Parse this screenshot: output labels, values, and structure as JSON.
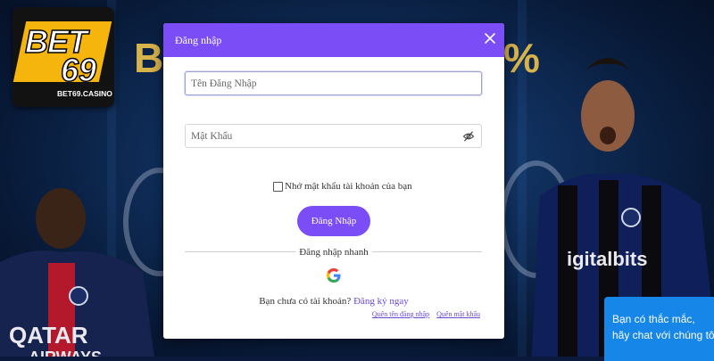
{
  "brand": {
    "logo_text_top": "BET",
    "logo_text_bottom": "69",
    "logo_subtext": "BET69.CASINO",
    "accent_color": "#7b4df6"
  },
  "login_modal": {
    "title": "Đăng nhập",
    "close_icon": "close-icon",
    "username_placeholder": "Tên Đăng Nhập",
    "password_placeholder": "Mật Khẩu",
    "password_toggle_icon": "eye-slash-icon",
    "remember_label": "Nhớ mật khẩu tài khoản của bạn",
    "submit_label": "Đăng Nhập",
    "quick_login_label": "Đăng nhập nhanh",
    "google_icon": "google-icon",
    "no_account_text": "Bạn chưa có tài khoản?",
    "signup_link": "Đăng ký ngay",
    "forgot_username": "Quên tên đăng nhập",
    "forgot_password": "Quên mật khẩu"
  },
  "chat_widget": {
    "line1": "Bạn có thắc mắc,",
    "line2": "hãy chat với chúng tôi"
  }
}
